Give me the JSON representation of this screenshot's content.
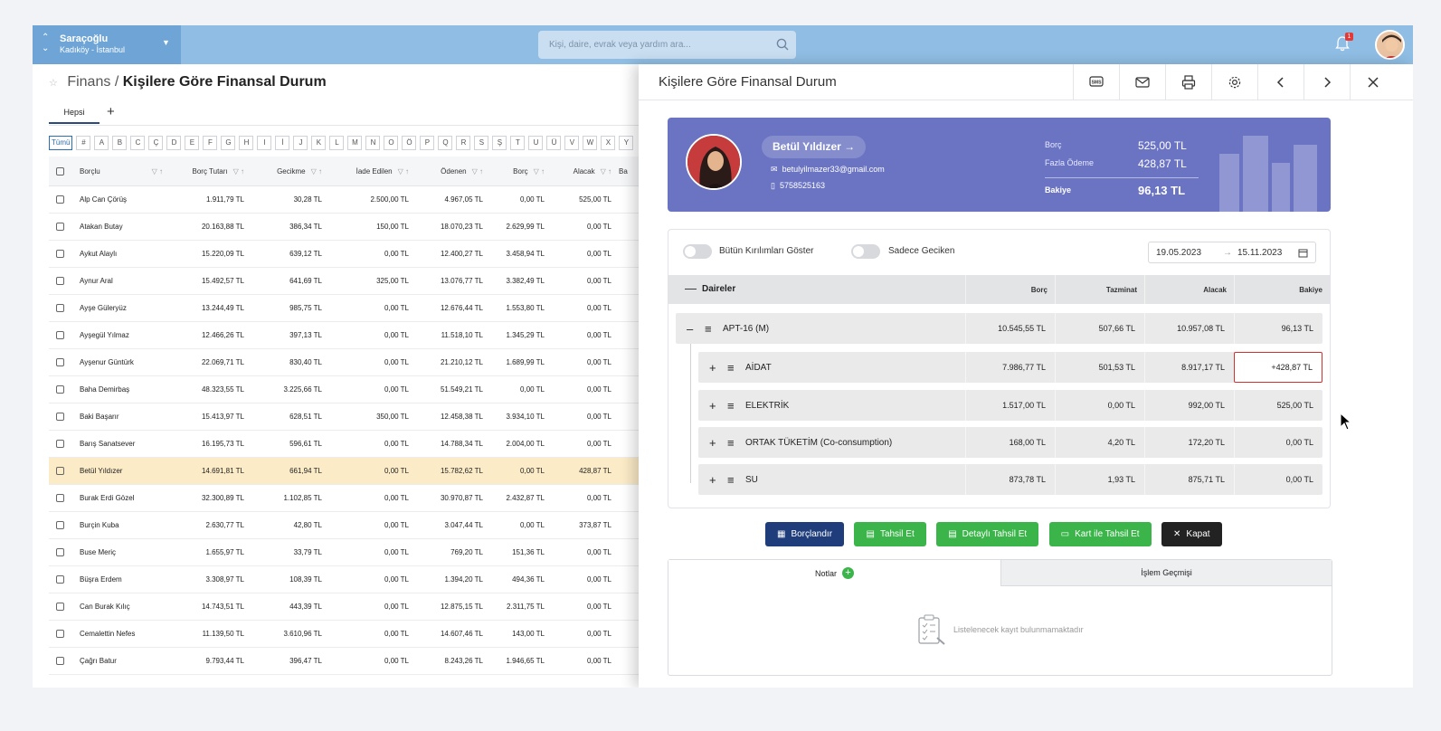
{
  "topbar": {
    "site_name": "Saraçoğlu",
    "site_location": "Kadıköy - İstanbul",
    "search_placeholder": "Kişi, daire, evrak veya yardım ara...",
    "notification_count": "1"
  },
  "breadcrumb": {
    "section": "Finans",
    "separator": "/",
    "page": "Kişilere Göre Finansal Durum"
  },
  "tabs": {
    "active": "Hepsi",
    "add": "+"
  },
  "letters": [
    "Tümü",
    "#",
    "A",
    "B",
    "C",
    "Ç",
    "D",
    "E",
    "F",
    "G",
    "H",
    "I",
    "İ",
    "J",
    "K",
    "L",
    "M",
    "N",
    "O",
    "Ö",
    "P",
    "Q",
    "R",
    "S",
    "Ş",
    "T",
    "U",
    "Ü",
    "V",
    "W",
    "X",
    "Y"
  ],
  "grid": {
    "columns": [
      "Borçlu",
      "Borç Tutarı",
      "Gecikme",
      "İade Edilen",
      "Ödenen",
      "Borç",
      "Alacak",
      "Ba"
    ],
    "rows": [
      [
        "Alp Can Çörüş",
        "1.911,79 TL",
        "30,28 TL",
        "2.500,00 TL",
        "4.967,05 TL",
        "0,00 TL",
        "525,00 TL"
      ],
      [
        "Atakan Butay",
        "20.163,88 TL",
        "386,34 TL",
        "150,00 TL",
        "18.070,23 TL",
        "2.629,99 TL",
        "0,00 TL"
      ],
      [
        "Aykut Alaylı",
        "15.220,09 TL",
        "639,12 TL",
        "0,00 TL",
        "12.400,27 TL",
        "3.458,94 TL",
        "0,00 TL"
      ],
      [
        "Aynur Aral",
        "15.492,57 TL",
        "641,69 TL",
        "325,00 TL",
        "13.076,77 TL",
        "3.382,49 TL",
        "0,00 TL"
      ],
      [
        "Ayşe Güleryüz",
        "13.244,49 TL",
        "985,75 TL",
        "0,00 TL",
        "12.676,44 TL",
        "1.553,80 TL",
        "0,00 TL"
      ],
      [
        "Ayşegül Yılmaz",
        "12.466,26 TL",
        "397,13 TL",
        "0,00 TL",
        "11.518,10 TL",
        "1.345,29 TL",
        "0,00 TL"
      ],
      [
        "Ayşenur Güntürk",
        "22.069,71 TL",
        "830,40 TL",
        "0,00 TL",
        "21.210,12 TL",
        "1.689,99 TL",
        "0,00 TL"
      ],
      [
        "Baha Demirbaş",
        "48.323,55 TL",
        "3.225,66 TL",
        "0,00 TL",
        "51.549,21 TL",
        "0,00 TL",
        "0,00 TL"
      ],
      [
        "Baki Başarır",
        "15.413,97 TL",
        "628,51 TL",
        "350,00 TL",
        "12.458,38 TL",
        "3.934,10 TL",
        "0,00 TL"
      ],
      [
        "Barış Sanatsever",
        "16.195,73 TL",
        "596,61 TL",
        "0,00 TL",
        "14.788,34 TL",
        "2.004,00 TL",
        "0,00 TL"
      ],
      [
        "Betül Yıldızer",
        "14.691,81 TL",
        "661,94 TL",
        "0,00 TL",
        "15.782,62 TL",
        "0,00 TL",
        "428,87 TL"
      ],
      [
        "Burak Erdi Gözel",
        "32.300,89 TL",
        "1.102,85 TL",
        "0,00 TL",
        "30.970,87 TL",
        "2.432,87 TL",
        "0,00 TL"
      ],
      [
        "Burçin Kuba",
        "2.630,77 TL",
        "42,80 TL",
        "0,00 TL",
        "3.047,44 TL",
        "0,00 TL",
        "373,87 TL"
      ],
      [
        "Buse Meriç",
        "1.655,97 TL",
        "33,79 TL",
        "0,00 TL",
        "769,20 TL",
        "151,36 TL",
        "0,00 TL"
      ],
      [
        "Büşra Erdem",
        "3.308,97 TL",
        "108,39 TL",
        "0,00 TL",
        "1.394,20 TL",
        "494,36 TL",
        "0,00 TL"
      ],
      [
        "Can Burak Kılıç",
        "14.743,51 TL",
        "443,39 TL",
        "0,00 TL",
        "12.875,15 TL",
        "2.311,75 TL",
        "0,00 TL"
      ],
      [
        "Cemalettin Nefes",
        "11.139,50 TL",
        "3.610,96 TL",
        "0,00 TL",
        "14.607,46 TL",
        "143,00 TL",
        "0,00 TL"
      ],
      [
        "Çağrı Batur",
        "9.793,44 TL",
        "396,47 TL",
        "0,00 TL",
        "8.243,26 TL",
        "1.946,65 TL",
        "0,00 TL"
      ]
    ]
  },
  "panel": {
    "title": "Kişilere Göre Finansal Durum",
    "person": {
      "name": "Betül Yıldızer",
      "email": "betulyilmazer33@gmail.com",
      "phone": "5758525163",
      "borc_label": "Borç",
      "borc": "525,00 TL",
      "fazla_label": "Fazla Ödeme",
      "fazla": "428,87 TL",
      "bakiye_label": "Bakiye",
      "bakiye": "96,13 TL"
    },
    "toggles": {
      "all_breakdowns": "Bütün Kırılımları Göster",
      "only_late": "Sadece Geciken"
    },
    "date_from": "19.05.2023",
    "date_to": "15.11.2023",
    "table": {
      "group": "Daireler",
      "cols": [
        "Borç",
        "Tazminat",
        "Alacak",
        "Bakiye"
      ],
      "unit": {
        "name": "APT-16 (M)",
        "values": [
          "10.545,55 TL",
          "507,66 TL",
          "10.957,08 TL",
          "96,13 TL"
        ]
      },
      "items": [
        {
          "name": "AİDAT",
          "values": [
            "7.986,77 TL",
            "501,53 TL",
            "8.917,17 TL",
            "+428,87 TL"
          ]
        },
        {
          "name": "ELEKTRİK",
          "values": [
            "1.517,00 TL",
            "0,00 TL",
            "992,00 TL",
            "525,00 TL"
          ]
        },
        {
          "name": "ORTAK TÜKETİM (Co-consumption)",
          "values": [
            "168,00 TL",
            "4,20 TL",
            "172,20 TL",
            "0,00 TL"
          ]
        },
        {
          "name": "SU",
          "values": [
            "873,78 TL",
            "1,93 TL",
            "875,71 TL",
            "0,00 TL"
          ]
        }
      ]
    },
    "actions": [
      "Borçlandır",
      "Tahsil Et",
      "Detaylı Tahsil Et",
      "Kart ile Tahsil Et",
      "Kapat"
    ],
    "notes_tab": "Notlar",
    "history_tab": "İşlem Geçmişi",
    "empty_text": "Listelenecek kayıt bulunmamaktadır"
  },
  "colors": {
    "topbar": "#8fbde3",
    "card": "#6b74c3",
    "selected_row": "#fbebc7",
    "highlight": "#d32f2f"
  }
}
